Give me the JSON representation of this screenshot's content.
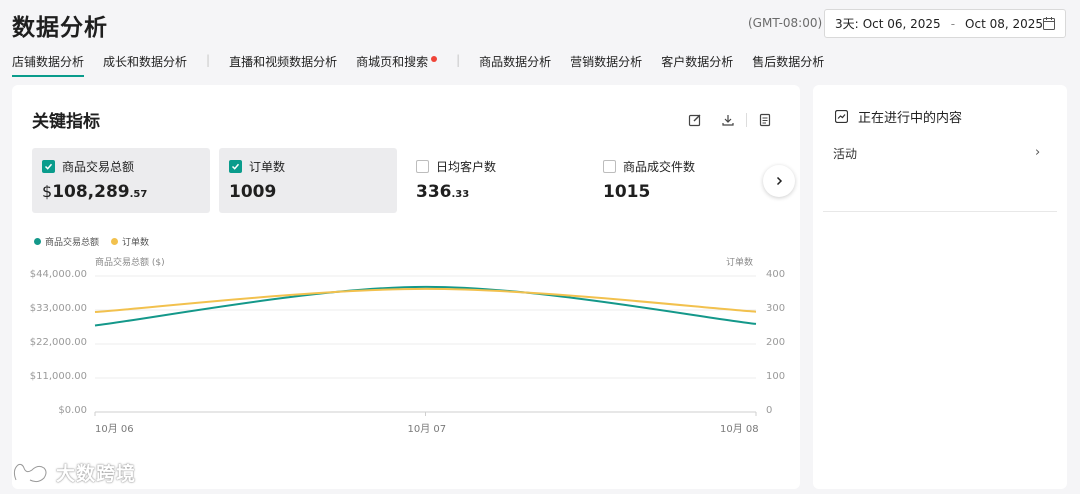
{
  "page": {
    "title": "数据分析",
    "timezone": "(GMT-08:00)",
    "date_range": {
      "prefix": "3天:",
      "start": "Oct 06, 2025",
      "separator": "-",
      "end": "Oct 08, 2025"
    }
  },
  "tabs": [
    {
      "label": "店铺数据分析",
      "active": true
    },
    {
      "label": "成长和数据分析"
    },
    {
      "label": "直播和视频数据分析"
    },
    {
      "label": "商城页和搜索",
      "dot": true
    },
    {
      "label": "商品数据分析"
    },
    {
      "label": "营销数据分析"
    },
    {
      "label": "客户数据分析"
    },
    {
      "label": "售后数据分析"
    }
  ],
  "kpi": {
    "title": "关键指标",
    "metrics": [
      {
        "label": "商品交易总额",
        "currency": "$",
        "value_main": "108,289",
        "value_decimal": ".57",
        "checked": true
      },
      {
        "label": "订单数",
        "value_main": "1009",
        "value_decimal": "",
        "checked": true
      },
      {
        "label": "日均客户数",
        "value_main": "336",
        "value_decimal": ".33",
        "checked": false
      },
      {
        "label": "商品成交件数",
        "value_main": "1015",
        "value_decimal": "",
        "checked": false
      }
    ]
  },
  "chart_data": {
    "type": "line",
    "x": [
      "10月 06",
      "10月 07",
      "10月 08"
    ],
    "series": [
      {
        "name": "商品交易总额",
        "axis": "left",
        "color": "#14988a",
        "values": [
          28000,
          40500,
          28500
        ]
      },
      {
        "name": "订单数",
        "axis": "right",
        "color": "#f2c14e",
        "values": [
          294,
          362,
          295
        ]
      }
    ],
    "ylabel_left": "商品交易总额 ($)",
    "ylabel_right": "订单数",
    "yticks_left": [
      "$44,000.00",
      "$33,000.00",
      "$22,000.00",
      "$11,000.00",
      "$0.00"
    ],
    "yticks_right": [
      "400",
      "300",
      "200",
      "100",
      "0"
    ],
    "ylim_left": [
      0,
      44000
    ],
    "ylim_right": [
      0,
      400
    ],
    "legend": "top-left",
    "grid": true
  },
  "side": {
    "title": "正在进行中的内容",
    "item": "活动"
  },
  "watermark": "大数跨境"
}
